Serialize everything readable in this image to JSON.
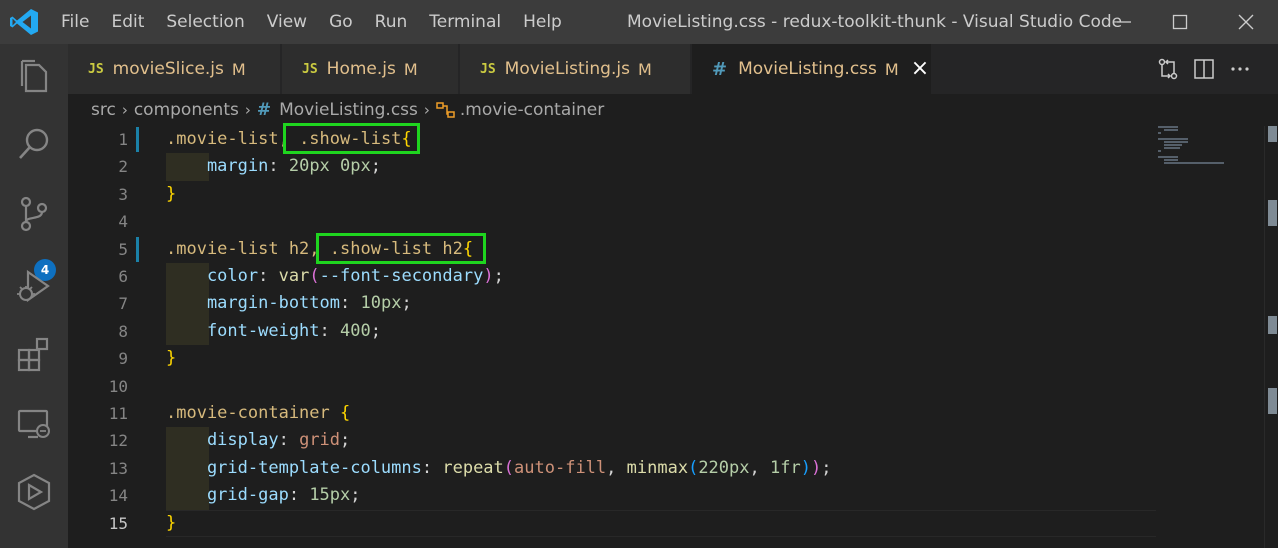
{
  "titlebar": {
    "menu": [
      "File",
      "Edit",
      "Selection",
      "View",
      "Go",
      "Run",
      "Terminal",
      "Help"
    ],
    "title": "MovieListing.css - redux-toolkit-thunk - Visual Studio Code"
  },
  "activity": {
    "icons": [
      "explorer-icon",
      "search-icon",
      "source-control-icon",
      "run-debug-icon",
      "extensions-icon",
      "remote-explorer-icon",
      "live-share-icon"
    ],
    "source_control_badge": "4"
  },
  "tabs": [
    {
      "badge": "JS",
      "label": "movieSlice.js",
      "status": "M"
    },
    {
      "badge": "JS",
      "label": "Home.js",
      "status": "M"
    },
    {
      "badge": "JS",
      "label": "MovieListing.js",
      "status": "M"
    },
    {
      "badge": "#",
      "label": "MovieListing.css",
      "status": "M",
      "active": true
    }
  ],
  "breadcrumb": {
    "parts": [
      "src",
      "components",
      "MovieListing.css",
      ".movie-container"
    ]
  },
  "editor": {
    "line_numbers": [
      "1",
      "2",
      "3",
      "4",
      "5",
      "6",
      "7",
      "8",
      "9",
      "10",
      "11",
      "12",
      "13",
      "14",
      "15"
    ],
    "active_line": "15",
    "lines": [
      [
        {
          "t": ".movie-list",
          "c": "sel"
        },
        {
          "t": ", .show-list",
          "c": "sel"
        },
        {
          "t": "{",
          "c": "br1"
        }
      ],
      [
        {
          "t": "    margin",
          "c": "prop"
        },
        {
          "t": ": ",
          "c": "punc"
        },
        {
          "t": "20px",
          "c": "num"
        },
        {
          "t": " ",
          "c": "punc"
        },
        {
          "t": "0px",
          "c": "num"
        },
        {
          "t": ";",
          "c": "punc"
        }
      ],
      [
        {
          "t": "}",
          "c": "br1"
        }
      ],
      [],
      [
        {
          "t": ".movie-list h2",
          "c": "sel"
        },
        {
          "t": ", .show-list h2",
          "c": "sel"
        },
        {
          "t": "{",
          "c": "br1"
        }
      ],
      [
        {
          "t": "    color",
          "c": "prop"
        },
        {
          "t": ": ",
          "c": "punc"
        },
        {
          "t": "var",
          "c": "fn"
        },
        {
          "t": "(",
          "c": "br2"
        },
        {
          "t": "--font-secondary",
          "c": "prop"
        },
        {
          "t": ")",
          "c": "br2"
        },
        {
          "t": ";",
          "c": "punc"
        }
      ],
      [
        {
          "t": "    margin-bottom",
          "c": "prop"
        },
        {
          "t": ": ",
          "c": "punc"
        },
        {
          "t": "10px",
          "c": "num"
        },
        {
          "t": ";",
          "c": "punc"
        }
      ],
      [
        {
          "t": "    font-weight",
          "c": "prop"
        },
        {
          "t": ": ",
          "c": "punc"
        },
        {
          "t": "400",
          "c": "num"
        },
        {
          "t": ";",
          "c": "punc"
        }
      ],
      [
        {
          "t": "}",
          "c": "br1"
        }
      ],
      [],
      [
        {
          "t": ".movie-container ",
          "c": "sel"
        },
        {
          "t": "{",
          "c": "br1"
        }
      ],
      [
        {
          "t": "    display",
          "c": "prop"
        },
        {
          "t": ": ",
          "c": "punc"
        },
        {
          "t": "grid",
          "c": "val"
        },
        {
          "t": ";",
          "c": "punc"
        }
      ],
      [
        {
          "t": "    grid-template-columns",
          "c": "prop"
        },
        {
          "t": ": ",
          "c": "punc"
        },
        {
          "t": "repeat",
          "c": "fn"
        },
        {
          "t": "(",
          "c": "br2"
        },
        {
          "t": "auto-fill",
          "c": "val"
        },
        {
          "t": ", ",
          "c": "punc"
        },
        {
          "t": "minmax",
          "c": "fn"
        },
        {
          "t": "(",
          "c": "br3"
        },
        {
          "t": "220px",
          "c": "num"
        },
        {
          "t": ", ",
          "c": "punc"
        },
        {
          "t": "1fr",
          "c": "num"
        },
        {
          "t": ")",
          "c": "br3"
        },
        {
          "t": ")",
          "c": "br2"
        },
        {
          "t": ";",
          "c": "punc"
        }
      ],
      [
        {
          "t": "    grid-gap",
          "c": "prop"
        },
        {
          "t": ": ",
          "c": "punc"
        },
        {
          "t": "15px",
          "c": "num"
        },
        {
          "t": ";",
          "c": "punc"
        }
      ],
      [
        {
          "t": "}",
          "c": "br1"
        }
      ]
    ]
  },
  "colors": {
    "highlight_box": "#1fd51f",
    "git_modified": "#1b81a8",
    "tab_modified": "#e2c08d"
  }
}
